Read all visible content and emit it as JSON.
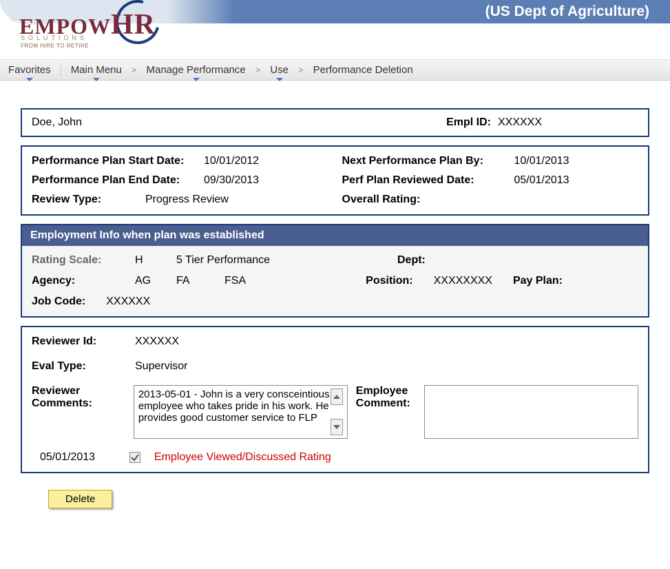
{
  "header": {
    "org_title": "(US Dept of Agriculture)",
    "logo_main": "EMPOW",
    "logo_hr": "HR",
    "logo_sub": "SOLUTIONS",
    "logo_tag": "FROM HIRE TO RETIRE"
  },
  "breadcrumb": {
    "favorites": "Favorites",
    "main_menu": "Main Menu",
    "manage_perf": "Manage Performance",
    "use": "Use",
    "perf_del": "Performance Deletion"
  },
  "employee": {
    "name": "Doe, John",
    "empl_id_label": "Empl ID:",
    "empl_id": "XXXXXX"
  },
  "plan": {
    "start_label": "Performance Plan Start Date:",
    "start_val": "10/01/2012",
    "end_label": "Performance Plan End Date:",
    "end_val": "09/30/2013",
    "review_type_label": "Review Type:",
    "review_type_val": "Progress Review",
    "next_label": "Next Performance Plan By:",
    "next_val": "10/01/2013",
    "reviewed_label": "Perf Plan Reviewed Date:",
    "reviewed_val": "05/01/2013",
    "overall_label": "Overall Rating:",
    "overall_val": ""
  },
  "emp_info": {
    "header": "Employment Info when plan was established",
    "rating_scale_label": "Rating Scale:",
    "rating_scale_code": "H",
    "rating_scale_desc": "5 Tier Performance",
    "dept_label": "Dept:",
    "dept_val": "",
    "agency_label": "Agency:",
    "agency_code1": "AG",
    "agency_code2": "FA",
    "agency_code3": "FSA",
    "position_label": "Position:",
    "position_val": "XXXXXXXX",
    "pay_plan_label": "Pay Plan:",
    "pay_plan_val": "",
    "job_code_label": "Job Code:",
    "job_code_val": "XXXXXX"
  },
  "reviewer": {
    "id_label": "Reviewer Id:",
    "id_val": "XXXXXX",
    "eval_type_label": "Eval Type:",
    "eval_type_val": "Supervisor",
    "comments_label": "Reviewer Comments:",
    "comments_text": "2013-05-01 -     John is a  very consceintious employee who takes pride in his  work.     He provides good customer service to FLP",
    "emp_comment_label": "Employee Comment:",
    "emp_comment_text": "",
    "viewed_date": "05/01/2013",
    "viewed_text": "Employee Viewed/Discussed Rating"
  },
  "buttons": {
    "delete": "Delete"
  }
}
